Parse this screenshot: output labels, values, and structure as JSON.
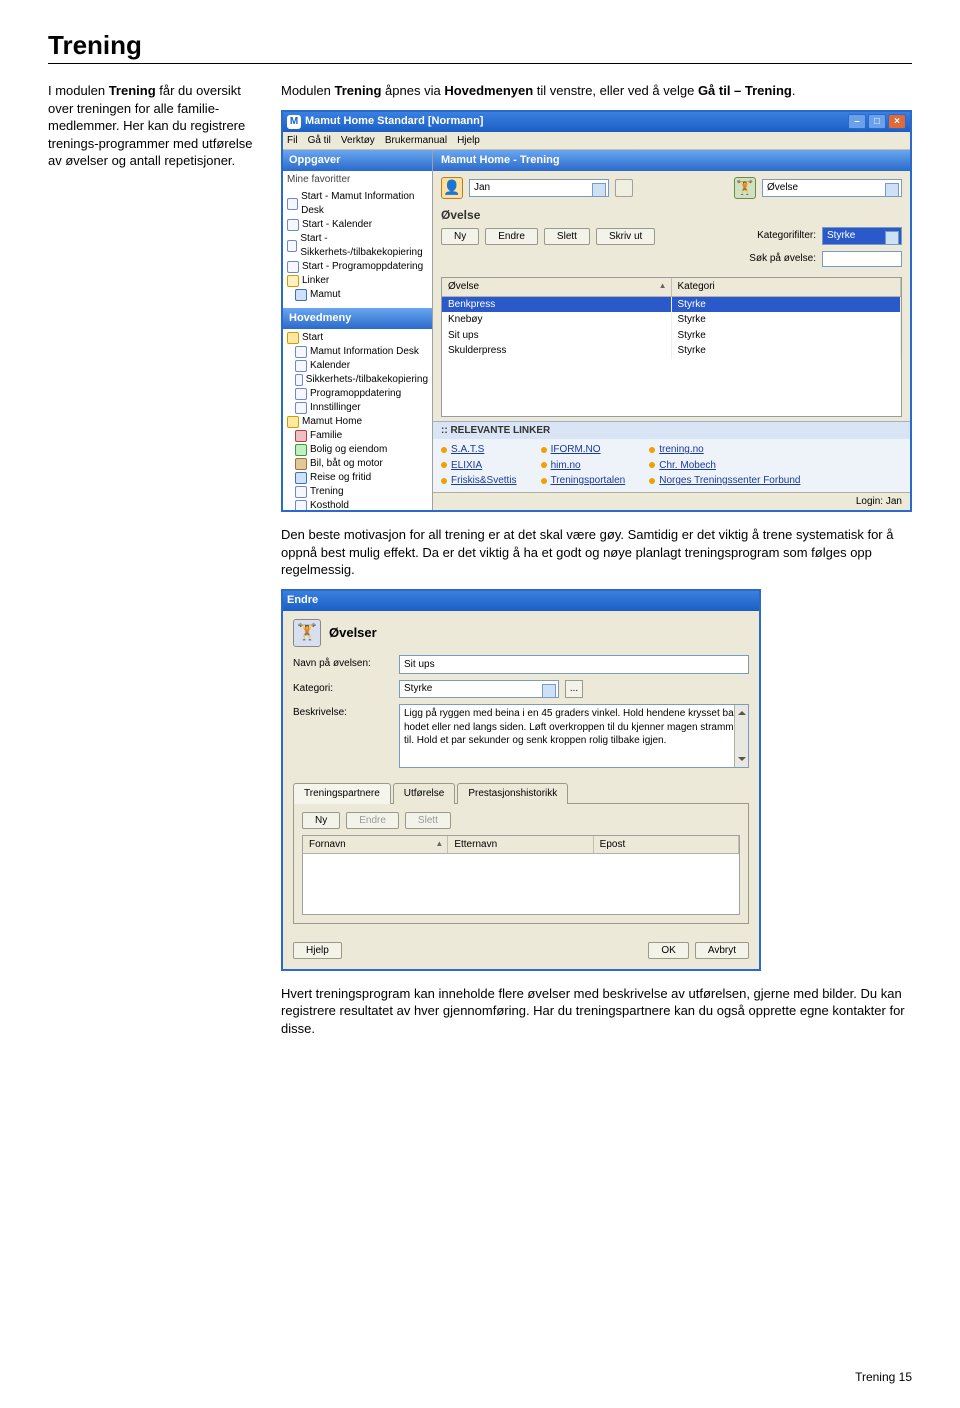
{
  "page": {
    "title": "Trening",
    "left_text_parts": {
      "p1a": "I modulen ",
      "p1b": "Trening",
      "p1c": " får du oversikt over treningen for alle familie-medlemmer. Her kan du registrere trenings-programmer med utførelse av øvelser og antall repetisjoner."
    },
    "right_intro_parts": {
      "a": "Modulen ",
      "b": "Trening",
      "c": " åpnes via ",
      "d": "Hovedmenyen",
      "e": " til venstre, eller ved å velge ",
      "f": "Gå til – Trening",
      "g": "."
    },
    "para2": "Den beste motivasjon for all trening er at det skal være gøy. Samtidig er det viktig å trene systematisk for å oppnå best mulig effekt. Da er det viktig å ha et godt og nøye planlagt treningsprogram som følges opp regelmessig.",
    "para3": "Hvert treningsprogram kan inneholde flere øvelser med beskrivelse av utførelsen, gjerne med bilder. Du kan registrere resultatet av hver gjennomføring. Har du treningspartnere kan du også opprette egne kontakter for disse.",
    "footer": "Trening   15"
  },
  "app": {
    "titlebar_icon": "M",
    "titlebar": "Mamut Home Standard  [Normann]",
    "min_label": "–",
    "max_label": "□",
    "close_label": "×",
    "menus": [
      "Fil",
      "Gå til",
      "Verktøy",
      "Brukermanual",
      "Hjelp"
    ],
    "sidebar_header": "Oppgaver",
    "fav_title": "Mine favoritter",
    "favs": [
      "Start - Mamut Information Desk",
      "Start - Kalender",
      "Start - Sikkerhets-/tilbakekopiering",
      "Start - Programoppdatering"
    ],
    "linker_label": "Linker",
    "linker_item": "Mamut",
    "hoved_header": "Hovedmeny",
    "tree_start": "Start",
    "tree_start_children": [
      "Mamut Information Desk",
      "Kalender",
      "Sikkerhets-/tilbakekopiering",
      "Programoppdatering",
      "Innstillinger"
    ],
    "tree_home": "Mamut Home",
    "tree_home_children": [
      "Familie",
      "Bolig og eiendom",
      "Bil, båt og motor",
      "Reise og fritid",
      "Trening",
      "Kosthold"
    ],
    "main_header": "Mamut Home - Trening",
    "person_dropdown": "Jan",
    "ovelse_label_dd": "Øvelse",
    "sub_header": "Øvelse",
    "btn_ny": "Ny",
    "btn_endre": "Endre",
    "btn_slett": "Slett",
    "btn_skrivut": "Skriv ut",
    "katfilter_label": "Kategorifilter:",
    "katfilter_value": "Styrke",
    "sok_label": "Søk på øvelse:",
    "th_ovelse": "Øvelse",
    "th_kategori": "Kategori",
    "rows": [
      {
        "o": "Benkpress",
        "k": "Styrke",
        "sel": true
      },
      {
        "o": "Knebøy",
        "k": "Styrke"
      },
      {
        "o": "Sit ups",
        "k": "Styrke"
      },
      {
        "o": "Skulderpress",
        "k": "Styrke"
      }
    ],
    "links_header": ":: RELEVANTE LINKER",
    "links_col1": [
      "S.A.T.S",
      "ELIXIA",
      "Friskis&Svettis"
    ],
    "links_col2": [
      "IFORM.NO",
      "him.no",
      "Treningsportalen"
    ],
    "links_col3": [
      "trening.no",
      "Chr. Mobech",
      "Norges Treningssenter Forbund"
    ],
    "status": "Login: Jan"
  },
  "dlg": {
    "title": "Endre",
    "heading": "Øvelser",
    "lbl_navn": "Navn på øvelsen:",
    "val_navn": "Sit ups",
    "lbl_kat": "Kategori:",
    "val_kat": "Styrke",
    "ellipsis": "...",
    "lbl_besk": "Beskrivelse:",
    "val_besk": "Ligg på ryggen med beina i en 45 graders vinkel. Hold hendene krysset bak hodet eller ned langs siden. Løft overkroppen til du kjenner magen strammer til. Hold et par sekunder og senk kroppen rolig tilbake igjen.",
    "tabs": [
      "Treningspartnere",
      "Utførelse",
      "Prestasjonshistorikk"
    ],
    "btn_ny": "Ny",
    "btn_endre": "Endre",
    "btn_slett": "Slett",
    "th_fornavn": "Fornavn",
    "th_etternavn": "Etternavn",
    "th_epost": "Epost",
    "btn_hjelp": "Hjelp",
    "btn_ok": "OK",
    "btn_avbryt": "Avbryt"
  }
}
